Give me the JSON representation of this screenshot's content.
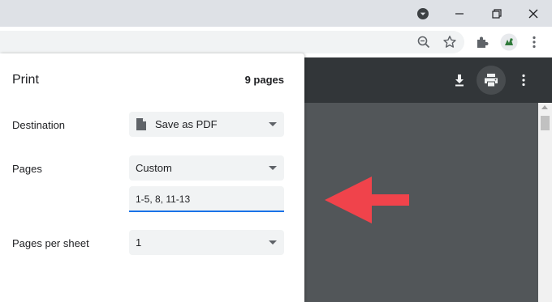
{
  "browser": {
    "profile_icon": "chevron-down-circle-icon",
    "window_controls": [
      "minimize-icon",
      "restore-icon",
      "close-icon"
    ],
    "toolbar_icons": [
      "zoom-icon",
      "star-icon",
      "extensions-icon",
      "avatar",
      "more-vert-icon"
    ]
  },
  "preview": {
    "header_icons": [
      "download-icon",
      "print-icon",
      "more-vert-icon"
    ],
    "annotation_arrow_color": "#f0434b"
  },
  "dialog": {
    "title": "Print",
    "page_count": "9 pages",
    "destination": {
      "label": "Destination",
      "value": "Save as PDF",
      "icon": "document-icon"
    },
    "pages": {
      "label": "Pages",
      "value": "Custom",
      "custom_input": "1-5, 8, 11-13"
    },
    "pages_per_sheet": {
      "label": "Pages per sheet",
      "value": "1"
    }
  },
  "colors": {
    "accent": "#1a73e8",
    "dark_header": "#323639",
    "preview_bg": "#525659"
  }
}
